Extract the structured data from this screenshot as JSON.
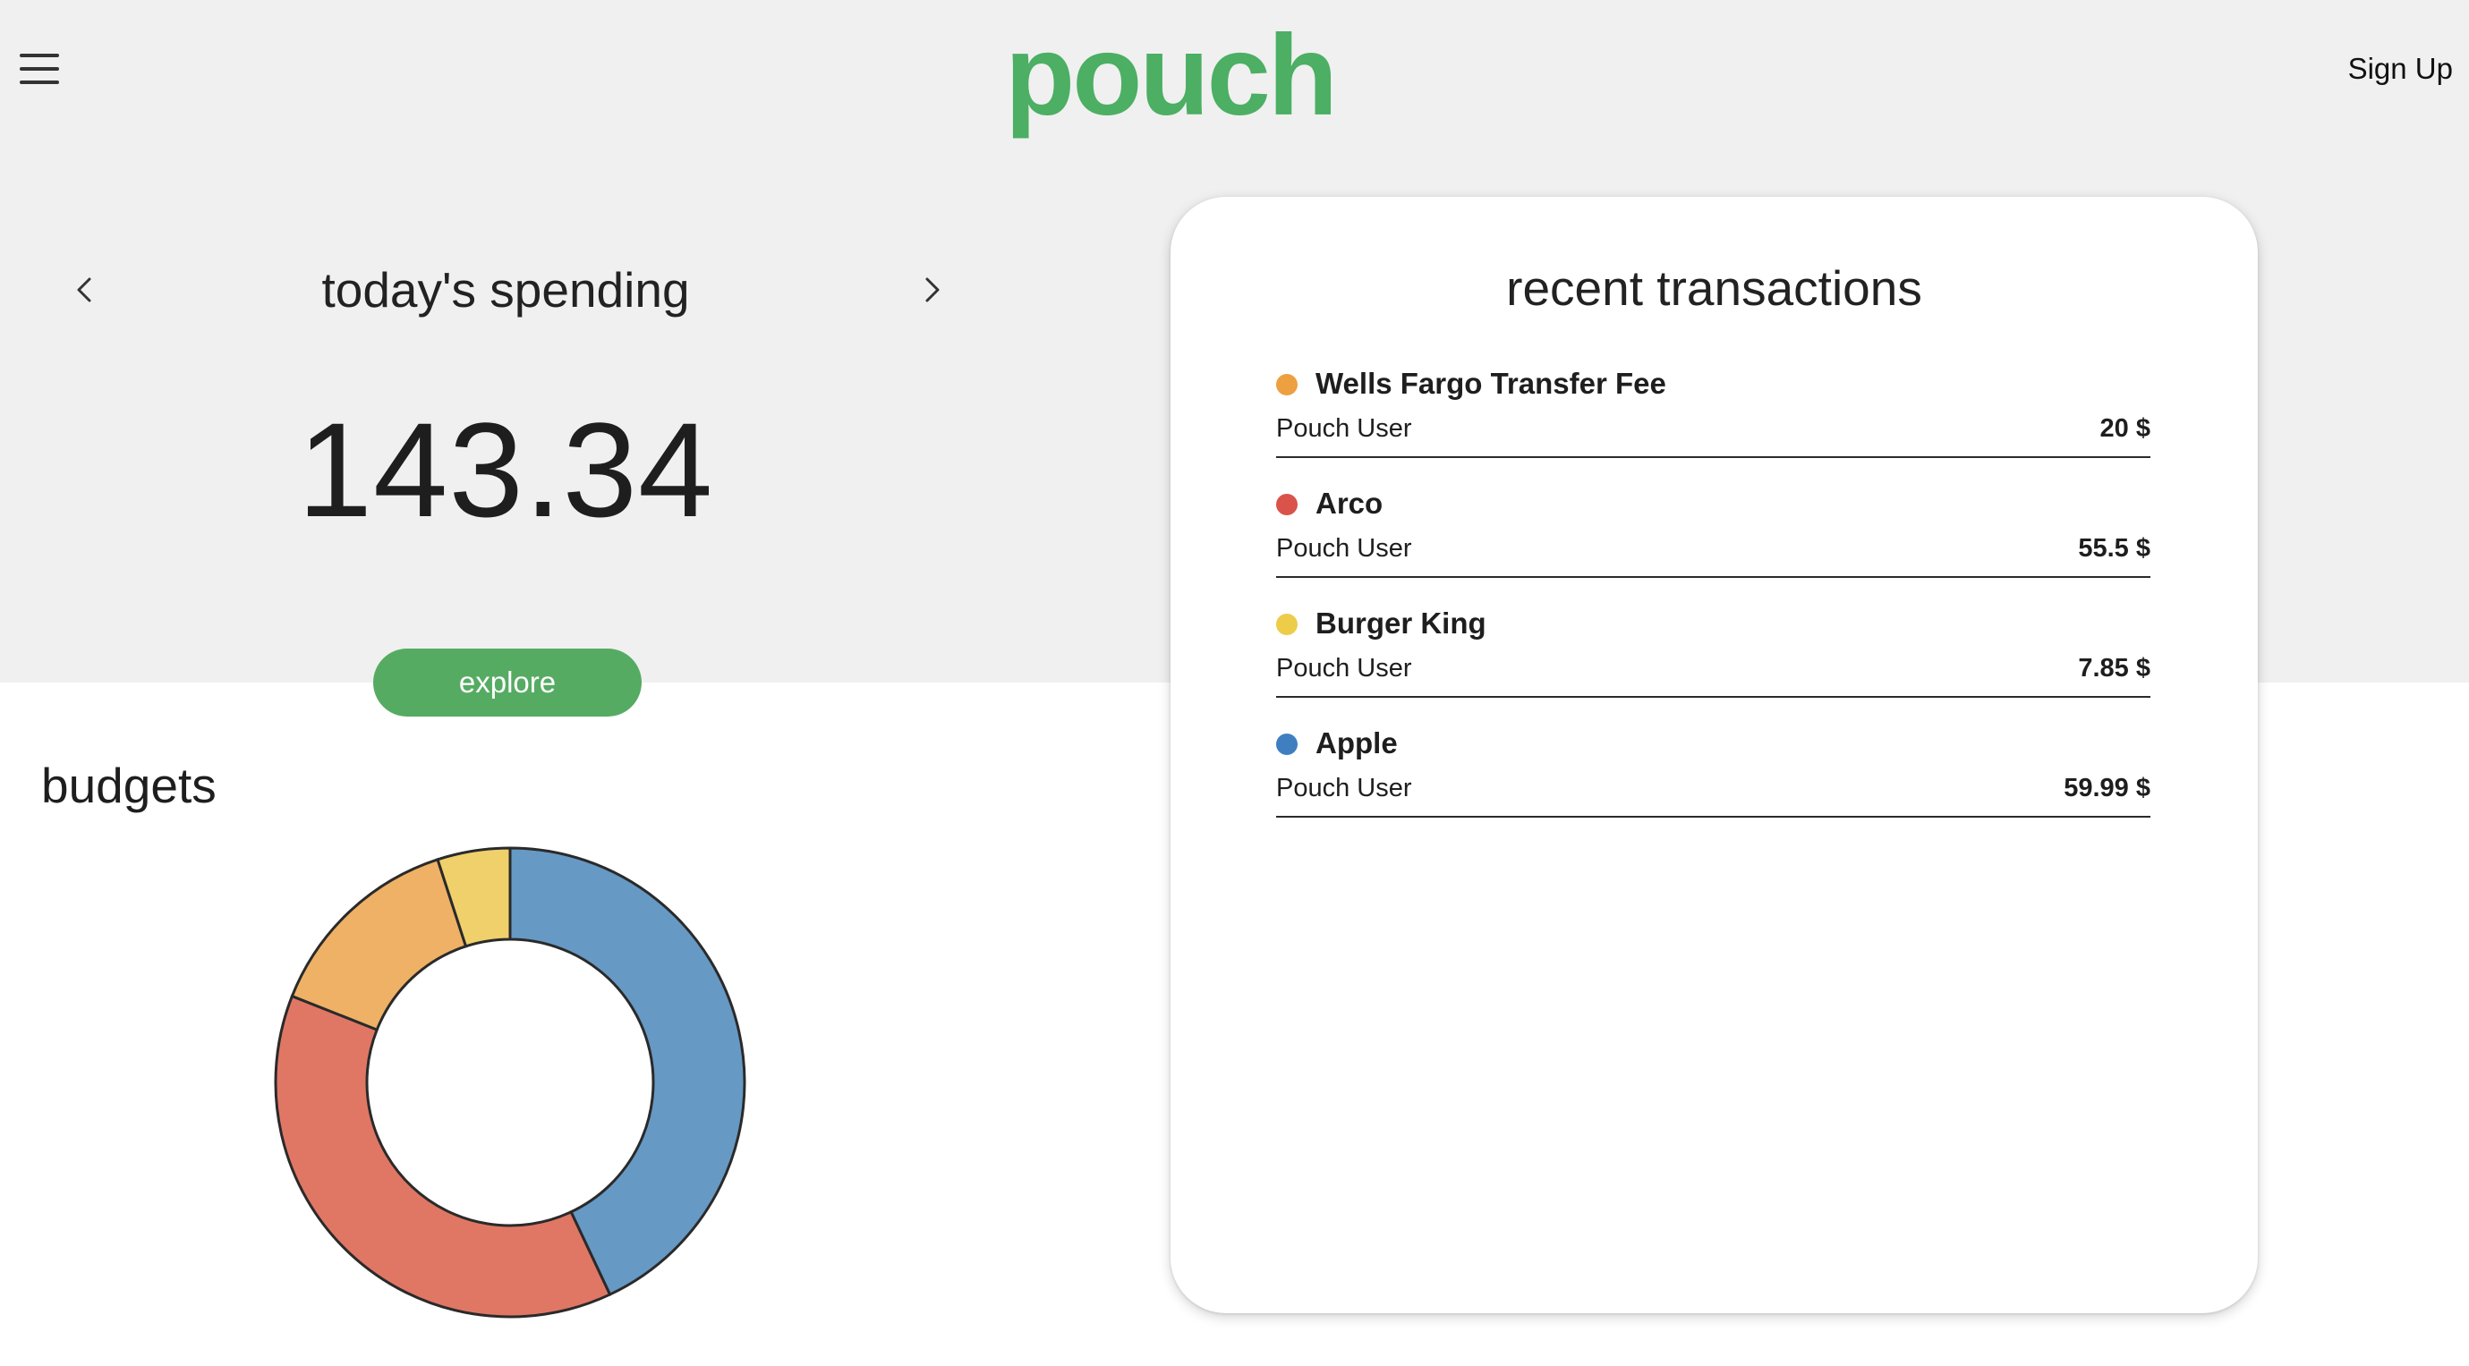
{
  "header": {
    "logo": "pouch",
    "signup_label": "Sign Up"
  },
  "spending": {
    "title": "today's spending",
    "amount": "143.34",
    "explore_label": "explore"
  },
  "budgets": {
    "title": "budgets"
  },
  "chart_data": {
    "type": "pie",
    "donut": true,
    "slices": [
      {
        "value": 43,
        "color": "#6699c4"
      },
      {
        "value": 38,
        "color": "#e07765"
      },
      {
        "value": 14,
        "color": "#eeb166"
      },
      {
        "value": 5,
        "color": "#efd06a"
      }
    ]
  },
  "transactions": {
    "title": "recent transactions",
    "items": [
      {
        "name": "Wells Fargo Transfer Fee",
        "user": "Pouch User",
        "amount": "20 $",
        "color": "#eda040"
      },
      {
        "name": "Arco",
        "user": "Pouch User",
        "amount": "55.5 $",
        "color": "#d9534a"
      },
      {
        "name": "Burger King",
        "user": "Pouch User",
        "amount": "7.85 $",
        "color": "#edcc4a"
      },
      {
        "name": "Apple",
        "user": "Pouch User",
        "amount": "59.99 $",
        "color": "#3f7fc0"
      }
    ]
  }
}
